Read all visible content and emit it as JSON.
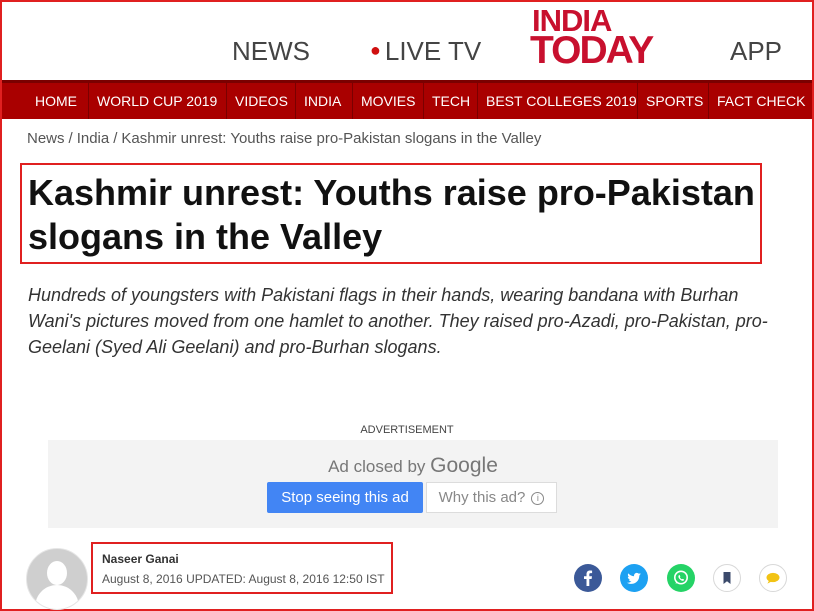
{
  "topbar": {
    "news": "NEWS",
    "live_tv": "LIVE TV",
    "logo_line1": "INDIA",
    "logo_line2": "TODAY",
    "app": "APP"
  },
  "nav": [
    "HOME",
    "WORLD CUP 2019",
    "VIDEOS",
    "INDIA",
    "MOVIES",
    "TECH",
    "BEST COLLEGES 2019",
    "SPORTS",
    "FACT CHECK"
  ],
  "breadcrumb": {
    "items": [
      "News",
      "India",
      "Kashmir unrest: Youths raise pro-Pakistan slogans in the Valley"
    ],
    "separator": "/"
  },
  "article": {
    "headline": "Kashmir unrest: Youths raise pro-Pakistan slogans in the Valley",
    "summary": "Hundreds of youngsters with Pakistani flags in their hands, wearing bandana with Burhan Wani's pictures moved from one hamlet to another. They raised pro-Azadi, pro-Pakistan, pro-Geelani (Syed Ali Geelani) and pro-Burhan slogans."
  },
  "ad": {
    "label": "ADVERTISEMENT",
    "closed_text": "Ad closed by",
    "closed_brand": "Google",
    "stop_button": "Stop seeing this ad",
    "why_button": "Why this ad?",
    "info_glyph": "i"
  },
  "author": {
    "name": "Naseer Ganai",
    "date_line": "August 8, 2016 UPDATED: August 8, 2016 12:50 IST"
  },
  "share_icons": [
    "facebook-icon",
    "twitter-icon",
    "whatsapp-icon",
    "bookmark-icon",
    "comment-icon"
  ],
  "colors": {
    "brand_red": "#c8102e",
    "nav_bg": "#a90000",
    "facebook": "#3b5998",
    "twitter": "#1da1f2",
    "whatsapp": "#25d366",
    "bookmark": "#3b4a6b",
    "comment": "#f2c314"
  }
}
